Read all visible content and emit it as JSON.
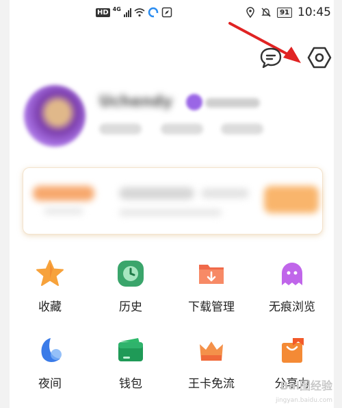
{
  "status_bar": {
    "hd_badge": "HD",
    "network_type": "4G",
    "battery_level": "91",
    "time": "10:45",
    "icons": [
      "signal-icon",
      "wifi-icon",
      "app-notification-icon",
      "compass-icon",
      "location-icon",
      "mute-icon",
      "battery-icon"
    ]
  },
  "header": {
    "icons": [
      "message-icon",
      "settings-icon"
    ],
    "annotation_arrow_color": "#e02323"
  },
  "profile": {
    "name": "Uchendy",
    "vip_color": "#9a66e6"
  },
  "grid": {
    "rows": [
      [
        {
          "label": "收藏",
          "icon": "star-icon",
          "color": "#f7a23b"
        },
        {
          "label": "历史",
          "icon": "clock-icon",
          "color": "#3aa56b"
        },
        {
          "label": "下载管理",
          "icon": "download-folder-icon",
          "color": "#f06a4a"
        },
        {
          "label": "无痕浏览",
          "icon": "ghost-icon",
          "color": "#b04fe0"
        }
      ],
      [
        {
          "label": "夜间",
          "icon": "moon-icon",
          "color": "#3a7be8"
        },
        {
          "label": "钱包",
          "icon": "wallet-icon",
          "color": "#1f9a57"
        },
        {
          "label": "王卡免流",
          "icon": "crown-icon",
          "color": "#f4914a"
        },
        {
          "label": "分享力",
          "icon": "share-bag-icon",
          "color": "#f48a35"
        }
      ]
    ]
  },
  "watermark": {
    "text": "Bai图经验",
    "url": "jingyan.baidu.com"
  }
}
